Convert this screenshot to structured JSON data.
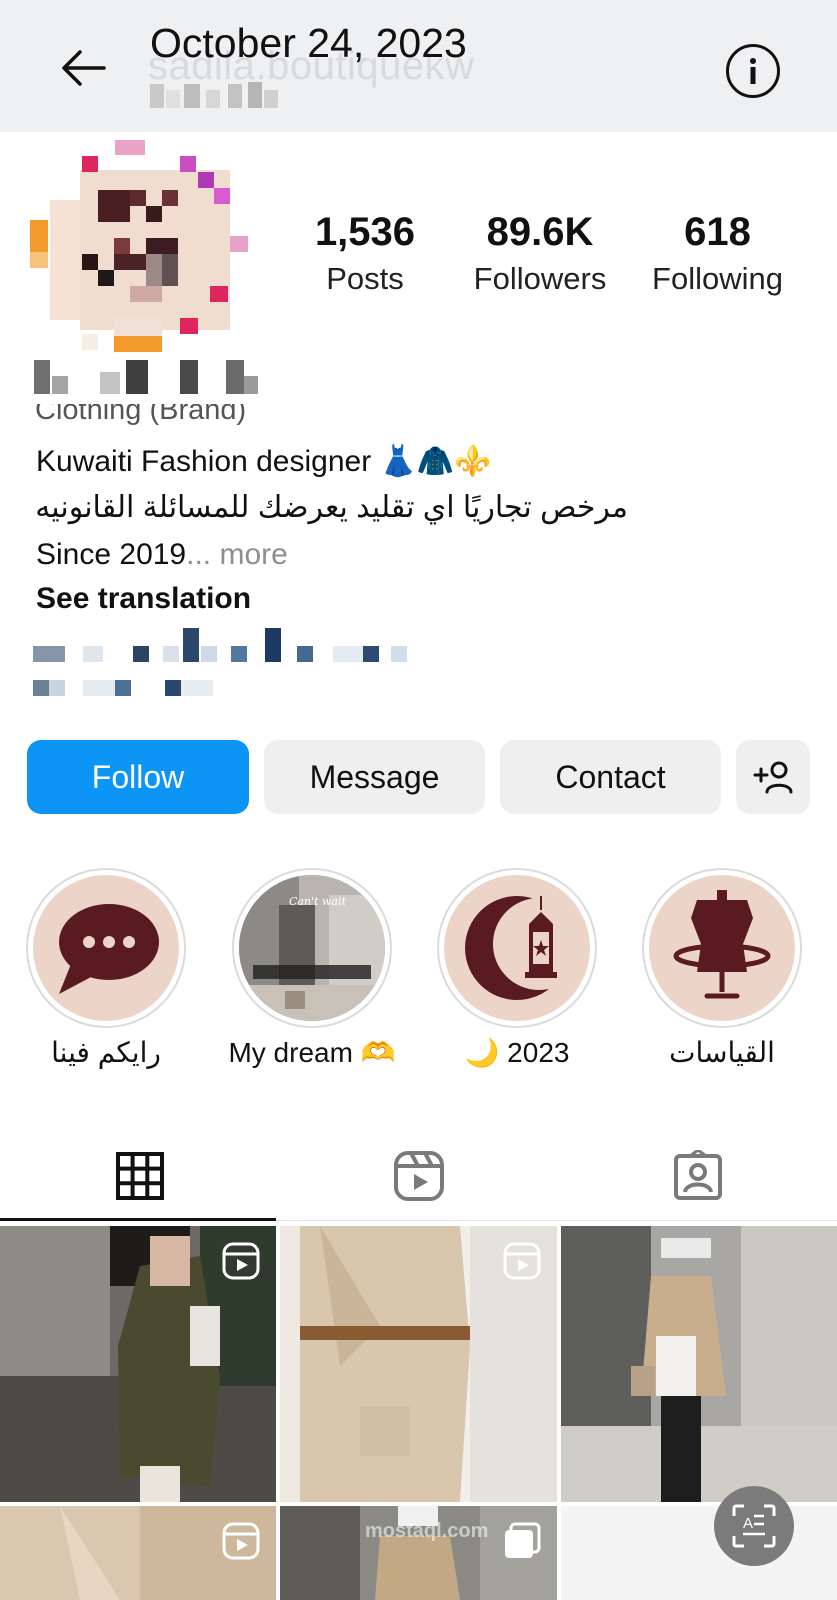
{
  "header": {
    "date_title": "October 24, 2023",
    "faded_username": "sadila.boutiquekw",
    "back_icon": "arrow-left-icon",
    "info_icon": "info-icon"
  },
  "stats": [
    {
      "value": "1,536",
      "label": "Posts"
    },
    {
      "value": "89.6K",
      "label": "Followers"
    },
    {
      "value": "618",
      "label": "Following"
    }
  ],
  "bio": {
    "cut_line": "Clothing (Brand)",
    "line1": "Kuwaiti Fashion designer",
    "line1_emoji": "👗🧥⚜️",
    "line2": "مرخص تجاريًا اي تقليد يعرضك للمسائلة القانونيه",
    "line3": "Since 2019",
    "more": "... more",
    "see_translation": "See translation"
  },
  "actions": {
    "follow": "Follow",
    "message": "Message",
    "contact": "Contact",
    "add_person_icon": "add-person-icon"
  },
  "highlights": [
    {
      "label": "رايكم فينا",
      "icon": "chat-bubble-icon"
    },
    {
      "label": "My dream 🫶",
      "icon": "photo-thumbnail",
      "overlay": "Can't wait"
    },
    {
      "label": "🌙 2023",
      "icon": "crescent-lantern-icon"
    },
    {
      "label": "القياسات",
      "icon": "mannequin-icon"
    }
  ],
  "tabs": [
    {
      "name": "grid",
      "icon": "grid-icon",
      "active": true
    },
    {
      "name": "reels",
      "icon": "reels-icon",
      "active": false
    },
    {
      "name": "tagged",
      "icon": "tagged-icon",
      "active": false
    }
  ],
  "colors": {
    "follow_blue": "#0d95f6",
    "highlight_bg": "#ecd5c8",
    "highlight_icon": "#5a1a22",
    "topbar_bg": "#eff0f2"
  },
  "watermark": "mostaql.com"
}
